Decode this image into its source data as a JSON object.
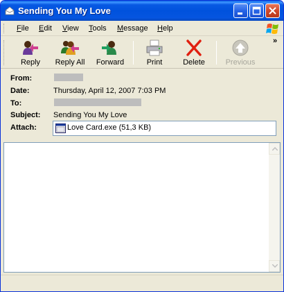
{
  "window": {
    "title": "Sending You My Love"
  },
  "menu": {
    "items": [
      "File",
      "Edit",
      "View",
      "Tools",
      "Message",
      "Help"
    ]
  },
  "toolbar": {
    "buttons": [
      {
        "label": "Reply",
        "icon": "reply-icon"
      },
      {
        "label": "Reply All",
        "icon": "reply-all-icon"
      },
      {
        "label": "Forward",
        "icon": "forward-icon"
      },
      {
        "label": "Print",
        "icon": "print-icon"
      },
      {
        "label": "Delete",
        "icon": "delete-icon"
      },
      {
        "label": "Previous",
        "icon": "previous-icon",
        "disabled": true
      }
    ],
    "more": "»"
  },
  "header": {
    "from_label": "From:",
    "date_label": "Date:",
    "date_value": "Thursday, April 12, 2007 7:03 PM",
    "to_label": "To:",
    "subject_label": "Subject:",
    "subject_value": "Sending You My Love",
    "attach_label": "Attach:",
    "attachment": "Love Card.exe (51,3 KB)"
  },
  "colors": {
    "titlebar": "#0054e3",
    "chrome": "#ece9d8",
    "delete_red": "#e02010"
  }
}
